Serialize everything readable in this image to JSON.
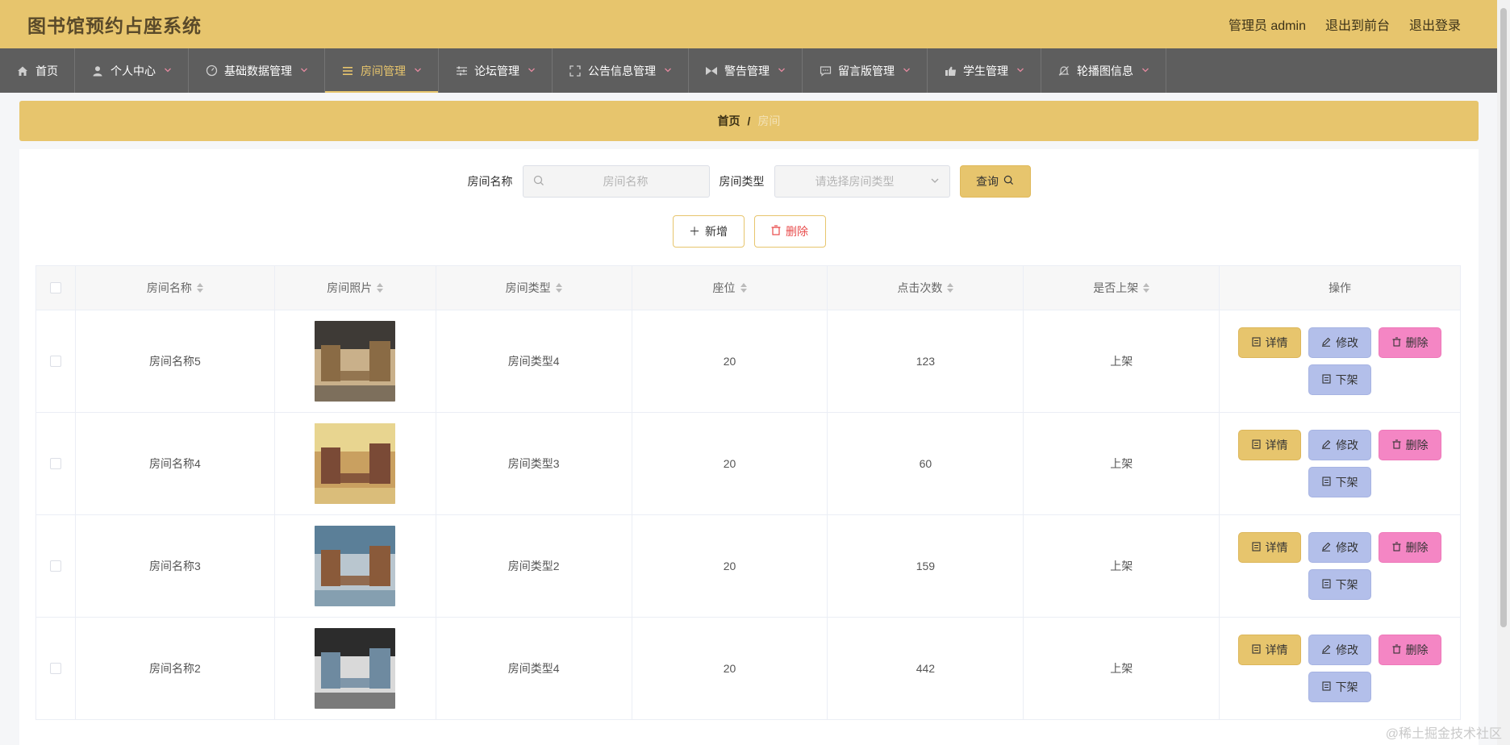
{
  "header": {
    "title": "图书馆预约占座系统",
    "admin_label": "管理员 admin",
    "back_front": "退出到前台",
    "logout": "退出登录"
  },
  "nav": [
    {
      "label": "首页",
      "icon": "home-icon",
      "active": false,
      "dropdown": false
    },
    {
      "label": "个人中心",
      "icon": "user-icon",
      "active": false,
      "dropdown": true
    },
    {
      "label": "基础数据管理",
      "icon": "dashboard-icon",
      "active": false,
      "dropdown": true
    },
    {
      "label": "房间管理",
      "icon": "menu-icon",
      "active": true,
      "dropdown": true
    },
    {
      "label": "论坛管理",
      "icon": "sliders-icon",
      "active": false,
      "dropdown": true
    },
    {
      "label": "公告信息管理",
      "icon": "fullscreen-icon",
      "active": false,
      "dropdown": true
    },
    {
      "label": "警告管理",
      "icon": "warning-icon",
      "active": false,
      "dropdown": true
    },
    {
      "label": "留言版管理",
      "icon": "chat-icon",
      "active": false,
      "dropdown": true
    },
    {
      "label": "学生管理",
      "icon": "thumb-icon",
      "active": false,
      "dropdown": true
    },
    {
      "label": "轮播图信息",
      "icon": "bell-off-icon",
      "active": false,
      "dropdown": true
    }
  ],
  "breadcrumb": {
    "home": "首页",
    "sep": "/",
    "current": "房间"
  },
  "search": {
    "name_label": "房间名称",
    "name_placeholder": "房间名称",
    "type_label": "房间类型",
    "type_placeholder": "请选择房间类型",
    "query_button": "查询"
  },
  "actions": {
    "add": "新增",
    "delete": "删除"
  },
  "table": {
    "headers": [
      "房间名称",
      "房间照片",
      "房间类型",
      "座位",
      "点击次数",
      "是否上架",
      "操作"
    ],
    "rows": [
      {
        "name": "房间名称5",
        "type": "房间类型4",
        "seats": "20",
        "clicks": "123",
        "status": "上架",
        "photo_colors": [
          "#3e3a36",
          "#8a6b45",
          "#c9b08a"
        ]
      },
      {
        "name": "房间名称4",
        "type": "房间类型3",
        "seats": "20",
        "clicks": "60",
        "status": "上架",
        "photo_colors": [
          "#e8d590",
          "#7a4a36",
          "#c9a060"
        ]
      },
      {
        "name": "房间名称3",
        "type": "房间类型2",
        "seats": "20",
        "clicks": "159",
        "status": "上架",
        "photo_colors": [
          "#5b7f98",
          "#8a5a3a",
          "#b9c6cf"
        ]
      },
      {
        "name": "房间名称2",
        "type": "房间类型4",
        "seats": "20",
        "clicks": "442",
        "status": "上架",
        "photo_colors": [
          "#2c2c2c",
          "#6e8aa0",
          "#d9d9d9"
        ]
      }
    ],
    "row_buttons": {
      "detail": "详情",
      "edit": "修改",
      "delete": "删除",
      "offshelf": "下架"
    }
  },
  "watermark": "@稀土掘金技术社区"
}
